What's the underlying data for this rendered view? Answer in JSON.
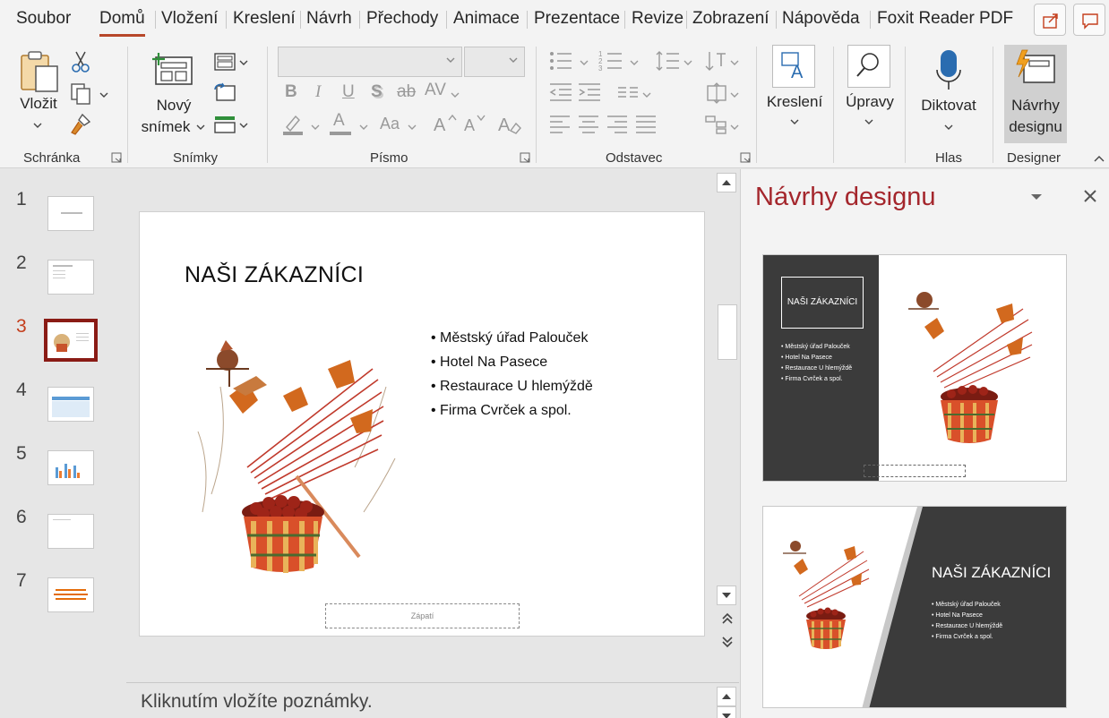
{
  "menu": {
    "tabs": [
      "Soubor",
      "Domů",
      "Vložení",
      "Kreslení",
      "Návrh",
      "Přechody",
      "Animace",
      "Prezentace",
      "Revize",
      "Zobrazení",
      "Nápověda",
      "Foxit Reader PDF"
    ],
    "active_tab": "Domů"
  },
  "ribbon": {
    "groups": {
      "clipboard": "Schránka",
      "slides": "Snímky",
      "font": "Písmo",
      "paragraph": "Odstavec",
      "voice": "Hlas",
      "designer": "Designer"
    },
    "buttons": {
      "paste_label": "Vložit",
      "new_slide_line1": "Nový",
      "new_slide_line2": "snímek",
      "drawing_label": "Kreslení",
      "editing_label": "Úpravy",
      "dictate_label": "Diktovat",
      "design_ideas_line1": "Návrhy",
      "design_ideas_line2": "designu"
    },
    "font": {
      "bold": "B",
      "italic": "I",
      "underline": "U",
      "shadow": "S",
      "strike": "ab",
      "spacing": "AV",
      "case": "Aa",
      "color_a": "A"
    }
  },
  "thumbnails": {
    "numbers": [
      "1",
      "2",
      "3",
      "4",
      "5",
      "6",
      "7"
    ],
    "active_index": 3
  },
  "slide": {
    "title": "NAŠI ZÁKAZNÍCI",
    "bullets": [
      "Městský úřad Palouček",
      "Hotel Na Pasece",
      "Restaurace U hlemýždě",
      "Firma Cvrček a spol."
    ],
    "footer": "Zápatí"
  },
  "notes": {
    "placeholder": "Kliknutím vložíte poznámky."
  },
  "designer": {
    "title": "Návrhy designu",
    "card1": {
      "title": "NAŠI ZÁKAZNÍCI",
      "bullets": [
        "Městský úřad Palouček",
        "Hotel Na Pasece",
        "Restaurace U hlemýždě",
        "Firma Cvrček a spol."
      ]
    },
    "card2": {
      "title": "NAŠI ZÁKAZNÍCI",
      "bullets": [
        "Městský úřad Palouček",
        "Hotel Na Pasece",
        "Restaurace U hlemýždě",
        "Firma Cvrček a spol."
      ]
    }
  },
  "colors": {
    "accent": "#b7472a",
    "designer_title": "#a4262c",
    "active_thumb_border": "#8a1b15",
    "dark_panel": "#3b3b3b"
  }
}
